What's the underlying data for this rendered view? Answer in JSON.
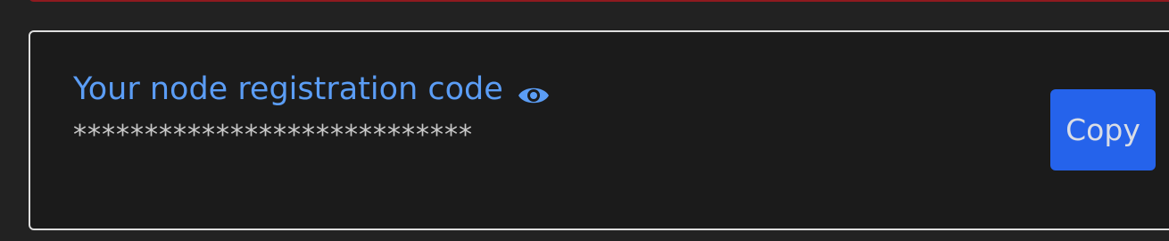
{
  "card": {
    "title": "Your node registration code",
    "toggle_icon": "eye-icon",
    "masked_code": "****************************",
    "copy_label": "Copy"
  },
  "colors": {
    "page_background": "#222222",
    "card_background": "#1b1b1b",
    "title": "#5b9df5",
    "button": "#2563eb",
    "alert_border": "#8e1a1f"
  }
}
